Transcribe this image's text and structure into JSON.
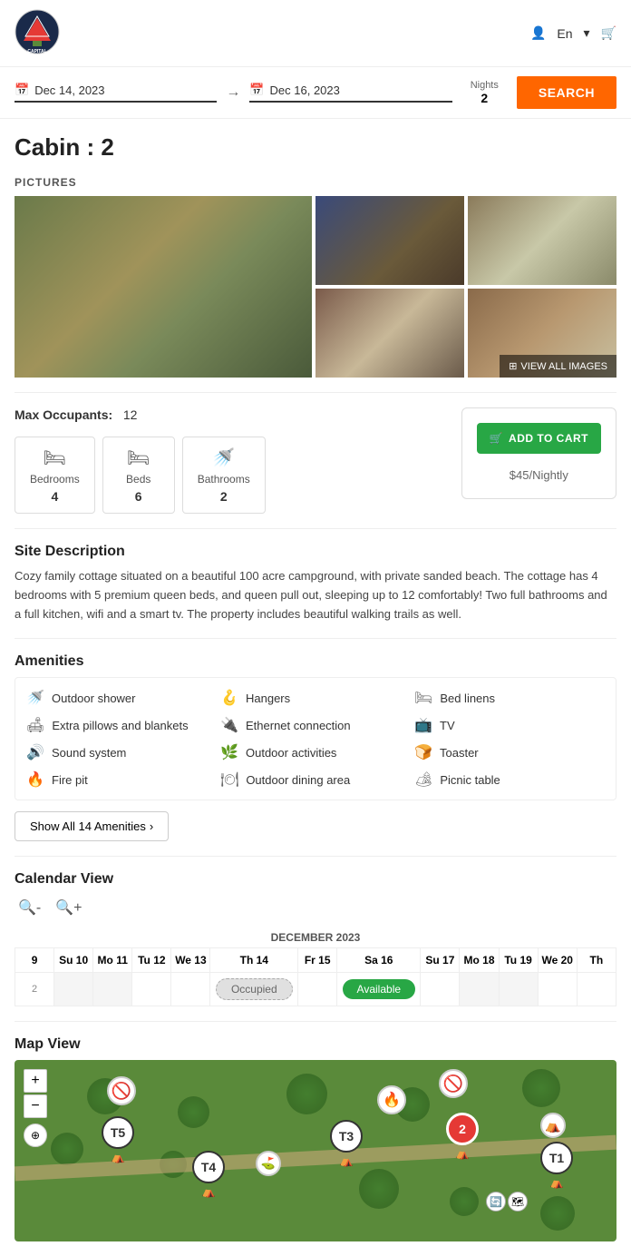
{
  "header": {
    "logo_alt": "Capital Camping Logo",
    "lang": "En",
    "cart_icon": "cart"
  },
  "search": {
    "date_from": "Dec 14, 2023",
    "date_to": "Dec 16, 2023",
    "nights_label": "Nights",
    "nights_value": "2",
    "button_label": "SEARCH",
    "calendar_icon": "calendar"
  },
  "cabin": {
    "title": "Cabin :  2",
    "pictures_label": "PICTURES",
    "view_all_label": "VIEW ALL IMAGES",
    "max_occupants_label": "Max Occupants:",
    "max_occupants_value": "12",
    "bedrooms_label": "Bedrooms",
    "bedrooms_value": "4",
    "beds_label": "Beds",
    "beds_value": "6",
    "bathrooms_label": "Bathrooms",
    "bathrooms_value": "2",
    "add_to_cart_label": "ADD TO CART",
    "price": "$45",
    "price_unit": "/Nightly",
    "site_desc_title": "Site Description",
    "site_desc_text": "Cozy family cottage situated on a beautiful 100 acre campground, with private sanded beach. The cottage has 4 bedrooms with 5 premium queen beds, and queen pull out, sleeping up to 12 comfortably! Two full bathrooms and a full kitchen, wifi and a smart tv. The property includes beautiful walking trails as well.",
    "amenities_title": "Amenities",
    "amenities": [
      {
        "icon": "🚿",
        "label": "Outdoor shower"
      },
      {
        "icon": "🪝",
        "label": "Hangers"
      },
      {
        "icon": "🛏",
        "label": "Bed linens"
      },
      {
        "icon": "🛋",
        "label": "Extra pillows and blankets"
      },
      {
        "icon": "🔌",
        "label": "Ethernet connection"
      },
      {
        "icon": "📺",
        "label": "TV"
      },
      {
        "icon": "🔊",
        "label": "Sound system"
      },
      {
        "icon": "🌿",
        "label": "Outdoor activities"
      },
      {
        "icon": "🍞",
        "label": "Toaster"
      },
      {
        "icon": "🔥",
        "label": "Fire pit"
      },
      {
        "icon": "🍽",
        "label": "Outdoor dining area"
      },
      {
        "icon": "🏕",
        "label": "Picnic table"
      }
    ],
    "show_all_label": "Show All 14 Amenities",
    "calendar_title": "Calendar View",
    "calendar_month": "DECEMBER 2023",
    "calendar_cols": [
      "9",
      "Su 10",
      "Mo 11",
      "Tu 12",
      "We 13",
      "Th 14",
      "Fr 15",
      "Sa 16",
      "Su 17",
      "Mo 18",
      "Tu 19",
      "We 20",
      "Th"
    ],
    "calendar_row_num": "2",
    "occupied_label": "Occupied",
    "available_label": "Available",
    "map_title": "Map View",
    "map_markers": [
      {
        "id": "T5",
        "color": "white"
      },
      {
        "id": "T4",
        "color": "white"
      },
      {
        "id": "T3",
        "color": "white"
      },
      {
        "id": "T1",
        "color": "white"
      },
      {
        "id": "2",
        "color": "red"
      }
    ]
  }
}
